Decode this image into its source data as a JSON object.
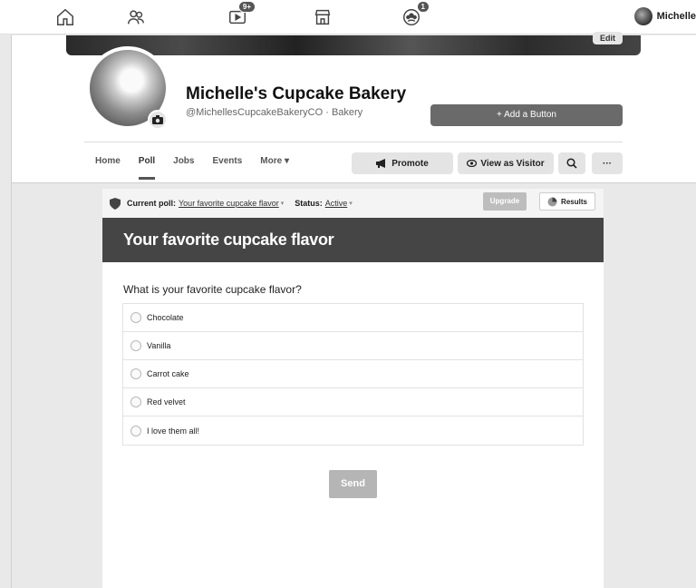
{
  "topnav": {
    "notifications_badge": "9+",
    "groups_badge": "1",
    "user_name": "Michelle"
  },
  "profile": {
    "edit_cover_label": "Edit",
    "page_name": "Michelle's Cupcake Bakery",
    "handle": "@MichellesCupcakeBakeryCO · Bakery",
    "add_button_label": "+ Add a Button"
  },
  "tabs": [
    "Home",
    "Poll",
    "Jobs",
    "Events",
    "More ▾"
  ],
  "actions": {
    "promote": "Promote",
    "view_as_visitor": "View as Visitor",
    "more": "···"
  },
  "poll": {
    "current_label": "Current poll:",
    "current_value": "Your favorite cupcake flavor",
    "status_label": "Status:",
    "status_value": "Active",
    "upgrade_label": "Upgrade",
    "results_label": "Results",
    "title": "Your favorite cupcake flavor",
    "question": "What is your favorite cupcake flavor?",
    "options": [
      "Chocolate",
      "Vanilla",
      "Carrot cake",
      "Red velvet",
      "I love them all!"
    ],
    "send_label": "Send"
  },
  "colors": {
    "accent": "#454545",
    "button_gray": "#6a6a6a"
  }
}
